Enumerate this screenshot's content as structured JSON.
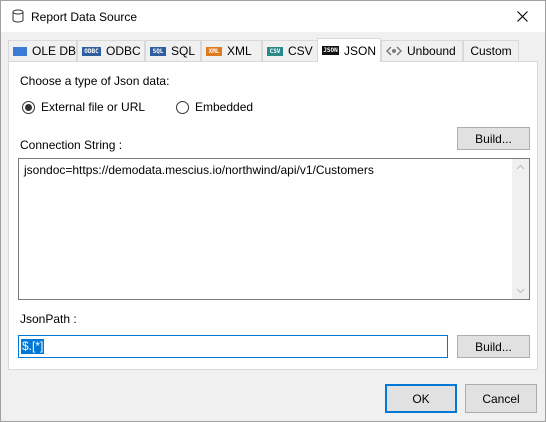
{
  "window": {
    "title": "Report Data Source",
    "close_icon": "close-icon"
  },
  "tabs": [
    {
      "label": "OLE DB",
      "icon": "oledb-icon",
      "icon_text": "",
      "icon_color": "#3a7bd5",
      "active": false
    },
    {
      "label": "ODBC",
      "icon": "odbc-icon",
      "icon_text": "ODBC",
      "icon_color": "#2f5f9e",
      "active": false
    },
    {
      "label": "SQL",
      "icon": "sql-icon",
      "icon_text": "SQL",
      "icon_color": "#2f5f9e",
      "active": false
    },
    {
      "label": "XML",
      "icon": "xml-icon",
      "icon_text": "XML",
      "icon_color": "#e07a20",
      "active": false
    },
    {
      "label": "CSV",
      "icon": "csv-icon",
      "icon_text": "CSV",
      "icon_color": "#2a8a8a",
      "active": false
    },
    {
      "label": "JSON",
      "icon": "json-icon",
      "icon_text": "JSON",
      "icon_color": "#111111",
      "active": true
    },
    {
      "label": "Unbound",
      "icon": "unbound-icon",
      "icon_text": "",
      "icon_color": "#7a7a7a",
      "active": false
    },
    {
      "label": "Custom",
      "icon": "",
      "icon_text": "",
      "icon_color": "",
      "active": false
    }
  ],
  "json_panel": {
    "type_prompt": "Choose a type of Json data:",
    "radio_external": "External file or URL",
    "radio_embedded": "Embedded",
    "selected": "external",
    "connection_label": "Connection String :",
    "connection_build": "Build...",
    "connection_value": "jsondoc=https://demodata.mescius.io/northwind/api/v1/Customers",
    "jsonpath_label": "JsonPath :",
    "jsonpath_value": "$.[*]",
    "jsonpath_build": "Build..."
  },
  "footer": {
    "ok": "OK",
    "cancel": "Cancel"
  },
  "colors": {
    "accent": "#0078d7",
    "panel_bg": "#f0f0f0"
  }
}
